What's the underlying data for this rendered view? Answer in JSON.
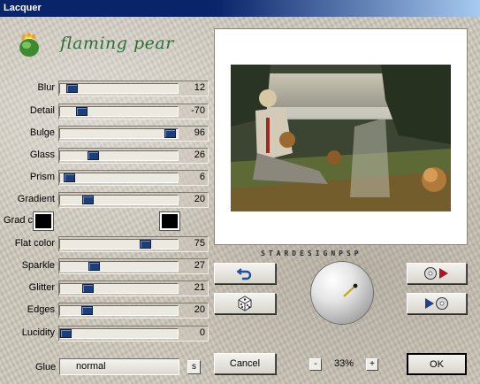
{
  "window": {
    "title": "Lacquer"
  },
  "brand": {
    "name": "flaming pear"
  },
  "sliders": [
    {
      "label": "Blur",
      "value": "12",
      "position": 0.06
    },
    {
      "label": "Detail",
      "value": "-70",
      "position": 0.15
    },
    {
      "label": "Bulge",
      "value": "96",
      "position": 0.98
    },
    {
      "label": "Glass",
      "value": "26",
      "position": 0.26
    },
    {
      "label": "Prism",
      "value": "6",
      "position": 0.03
    },
    {
      "label": "Gradient",
      "value": "20",
      "position": 0.21
    },
    {
      "label": "Flat color",
      "value": "75",
      "position": 0.75
    },
    {
      "label": "Sparkle",
      "value": "27",
      "position": 0.27
    },
    {
      "label": "Glitter",
      "value": "21",
      "position": 0.21
    },
    {
      "label": "Edges",
      "value": "20",
      "position": 0.2
    },
    {
      "label": "Lucidity",
      "value": "0",
      "position": 0.0
    }
  ],
  "grad_colors": {
    "label": "Grad colors",
    "color_a": "#000000",
    "color_b": "#000000"
  },
  "maker_label": "STARDESIGNPSP",
  "glue": {
    "label": "Glue",
    "value": "normal",
    "save_label": "s"
  },
  "buttons": {
    "cancel": "Cancel",
    "ok": "OK"
  },
  "zoom": {
    "minus": "-",
    "value": "33%",
    "plus": "+"
  },
  "icons": {
    "undo": "undo-arrow-icon",
    "random": "dice-icon",
    "save_preset": "disc-to-arrow-icon",
    "load_preset": "arrow-to-disc-icon",
    "logo": "flaming-pear-logo-icon"
  },
  "colors": {
    "title_bar": "#0a246a",
    "slider_thumb": "#1c3e7a",
    "brand_text": "#2e6f3b"
  }
}
